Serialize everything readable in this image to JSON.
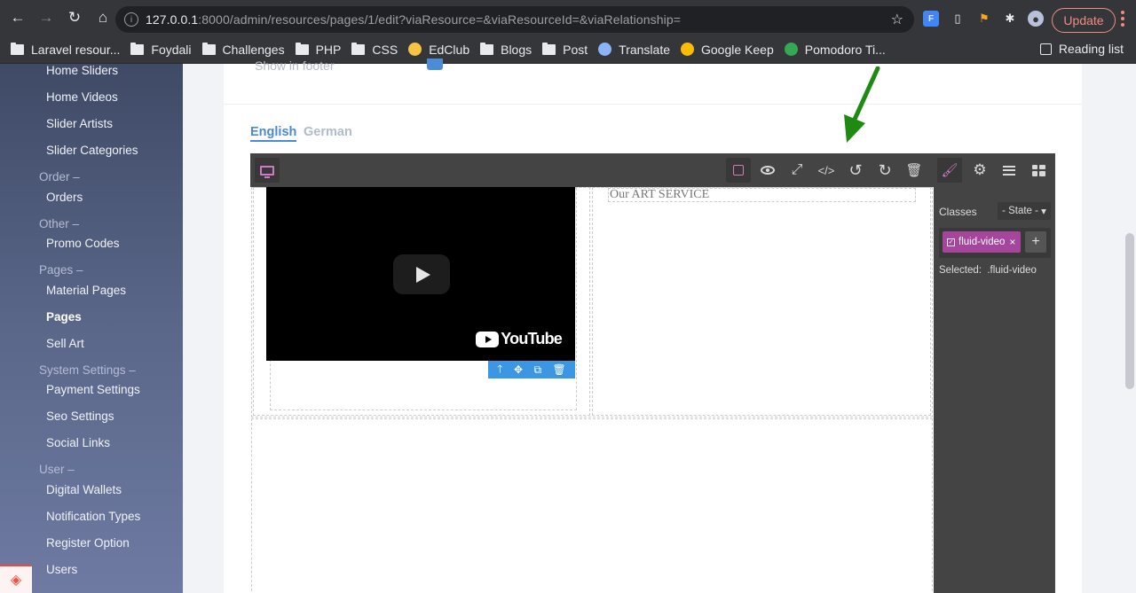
{
  "browser": {
    "url_host": "127.0.0.1",
    "url_rest": ":8000/admin/resources/pages/1/edit?viaResource=&viaResourceId=&viaRelationship=",
    "update_label": "Update",
    "bookmarks": [
      {
        "label": "Laravel resour...",
        "icon": "folder-icon"
      },
      {
        "label": "Foydali",
        "icon": "folder-icon"
      },
      {
        "label": "Challenges",
        "icon": "folder-icon"
      },
      {
        "label": "PHP",
        "icon": "folder-icon"
      },
      {
        "label": "CSS",
        "icon": "folder-icon"
      },
      {
        "label": "EdClub",
        "icon": "edclub-icon"
      },
      {
        "label": "Blogs",
        "icon": "folder-icon"
      },
      {
        "label": "Post",
        "icon": "folder-icon"
      },
      {
        "label": "Translate",
        "icon": "translate-icon"
      },
      {
        "label": "Google Keep",
        "icon": "keep-icon"
      },
      {
        "label": "Pomodoro Ti...",
        "icon": "pomodoro-icon"
      }
    ],
    "reading_list": "Reading list"
  },
  "sidebar": {
    "items": [
      {
        "label": "Home Sliders",
        "type": "item"
      },
      {
        "label": "Home Videos",
        "type": "item"
      },
      {
        "label": "Slider Artists",
        "type": "item"
      },
      {
        "label": "Slider Categories",
        "type": "item"
      },
      {
        "label": "Order –",
        "type": "group"
      },
      {
        "label": "Orders",
        "type": "item"
      },
      {
        "label": "Other –",
        "type": "group"
      },
      {
        "label": "Promo Codes",
        "type": "item"
      },
      {
        "label": "Pages –",
        "type": "group"
      },
      {
        "label": "Material Pages",
        "type": "item"
      },
      {
        "label": "Pages",
        "type": "item",
        "active": true
      },
      {
        "label": "Sell Art",
        "type": "item"
      },
      {
        "label": "System Settings –",
        "type": "group"
      },
      {
        "label": "Payment Settings",
        "type": "item"
      },
      {
        "label": "Seo Settings",
        "type": "item"
      },
      {
        "label": "Social Links",
        "type": "item"
      },
      {
        "label": "User –",
        "type": "group"
      },
      {
        "label": "Digital Wallets",
        "type": "item"
      },
      {
        "label": "Notification Types",
        "type": "item"
      },
      {
        "label": "Register Option",
        "type": "item"
      },
      {
        "label": "Users",
        "type": "item"
      }
    ]
  },
  "form": {
    "partial_label": "Show in footer",
    "tabs": {
      "english": "English",
      "german": "German"
    }
  },
  "editor": {
    "text_block": "Our ART SERVICE",
    "video_brand": "YouTube",
    "classes_label": "Classes",
    "state_select": "- State -",
    "selected_class": "fluid-video",
    "selected_label": "Selected:",
    "selected_value": ".fluid-video",
    "accent_color": "#d278c9",
    "tag_color": "#a5459e",
    "toolbar_color": "#3b97e3"
  }
}
